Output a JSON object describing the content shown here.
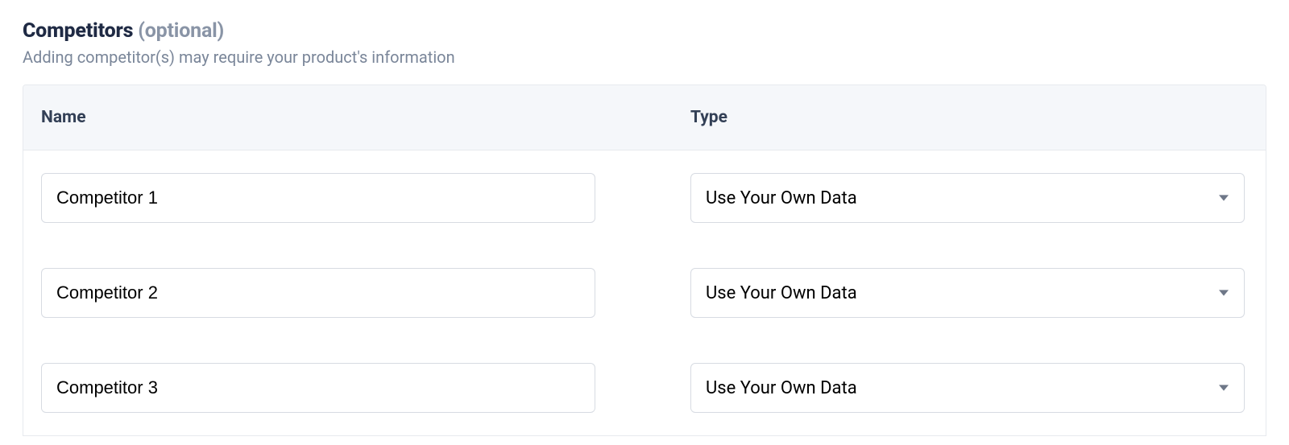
{
  "section": {
    "title": "Competitors",
    "optional": "(optional)",
    "subtitle": "Adding competitor(s) may require your product's information"
  },
  "columns": {
    "name": "Name",
    "type": "Type"
  },
  "rows": [
    {
      "name": "Competitor 1",
      "type": "Use Your Own Data"
    },
    {
      "name": "Competitor 2",
      "type": "Use Your Own Data"
    },
    {
      "name": "Competitor 3",
      "type": "Use Your Own Data"
    }
  ]
}
